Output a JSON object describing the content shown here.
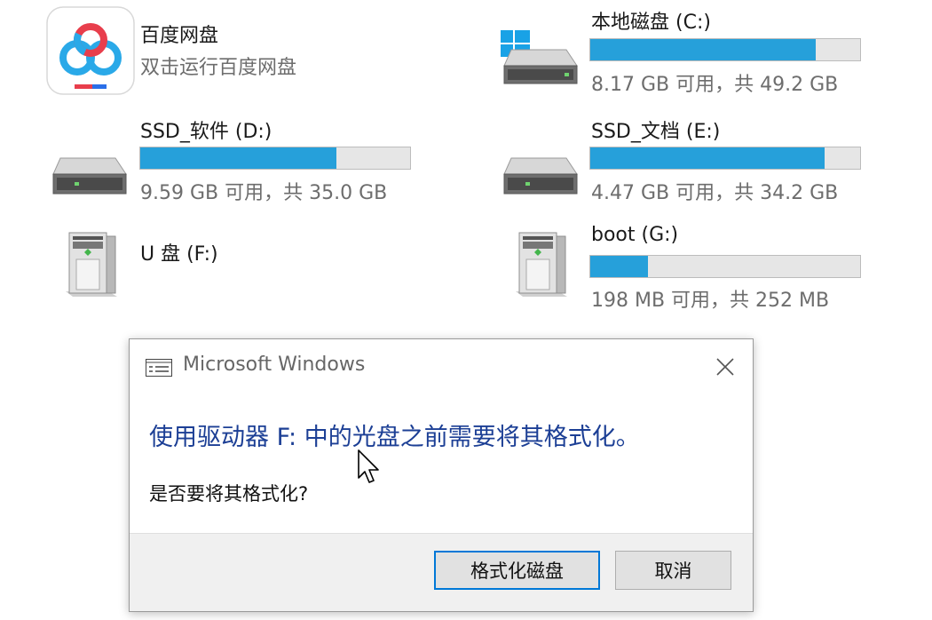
{
  "apps": [
    {
      "name": "百度网盘",
      "subtitle": "双击运行百度网盘",
      "icon": "baidu-netdisk-icon"
    }
  ],
  "drives": [
    {
      "id": "c",
      "name": "本地磁盘 (C:)",
      "usage": "8.17 GB 可用，共 49.2 GB",
      "used_fraction": 0.834,
      "icon": "windows-system-drive-icon"
    },
    {
      "id": "d",
      "name": "SSD_软件 (D:)",
      "usage": "9.59 GB 可用，共 35.0 GB",
      "used_fraction": 0.726,
      "icon": "hard-drive-icon"
    },
    {
      "id": "e",
      "name": "SSD_文档 (E:)",
      "usage": "4.47 GB 可用，共 34.2 GB",
      "used_fraction": 0.869,
      "icon": "hard-drive-icon"
    },
    {
      "id": "f",
      "name": "U 盘 (F:)",
      "icon": "removable-drive-icon"
    },
    {
      "id": "g",
      "name": "boot (G:)",
      "usage": "198 MB 可用，共 252 MB",
      "used_fraction": 0.214,
      "icon": "removable-drive-icon"
    }
  ],
  "dialog": {
    "title": "Microsoft Windows",
    "message": "使用驱动器 F: 中的光盘之前需要将其格式化。",
    "question": "是否要将其格式化?",
    "buttons": {
      "format": "格式化磁盘",
      "cancel": "取消"
    }
  },
  "colors": {
    "bar_fill": "#26a0da",
    "message_text": "#1c3f95",
    "primary_border": "#0078d7"
  }
}
